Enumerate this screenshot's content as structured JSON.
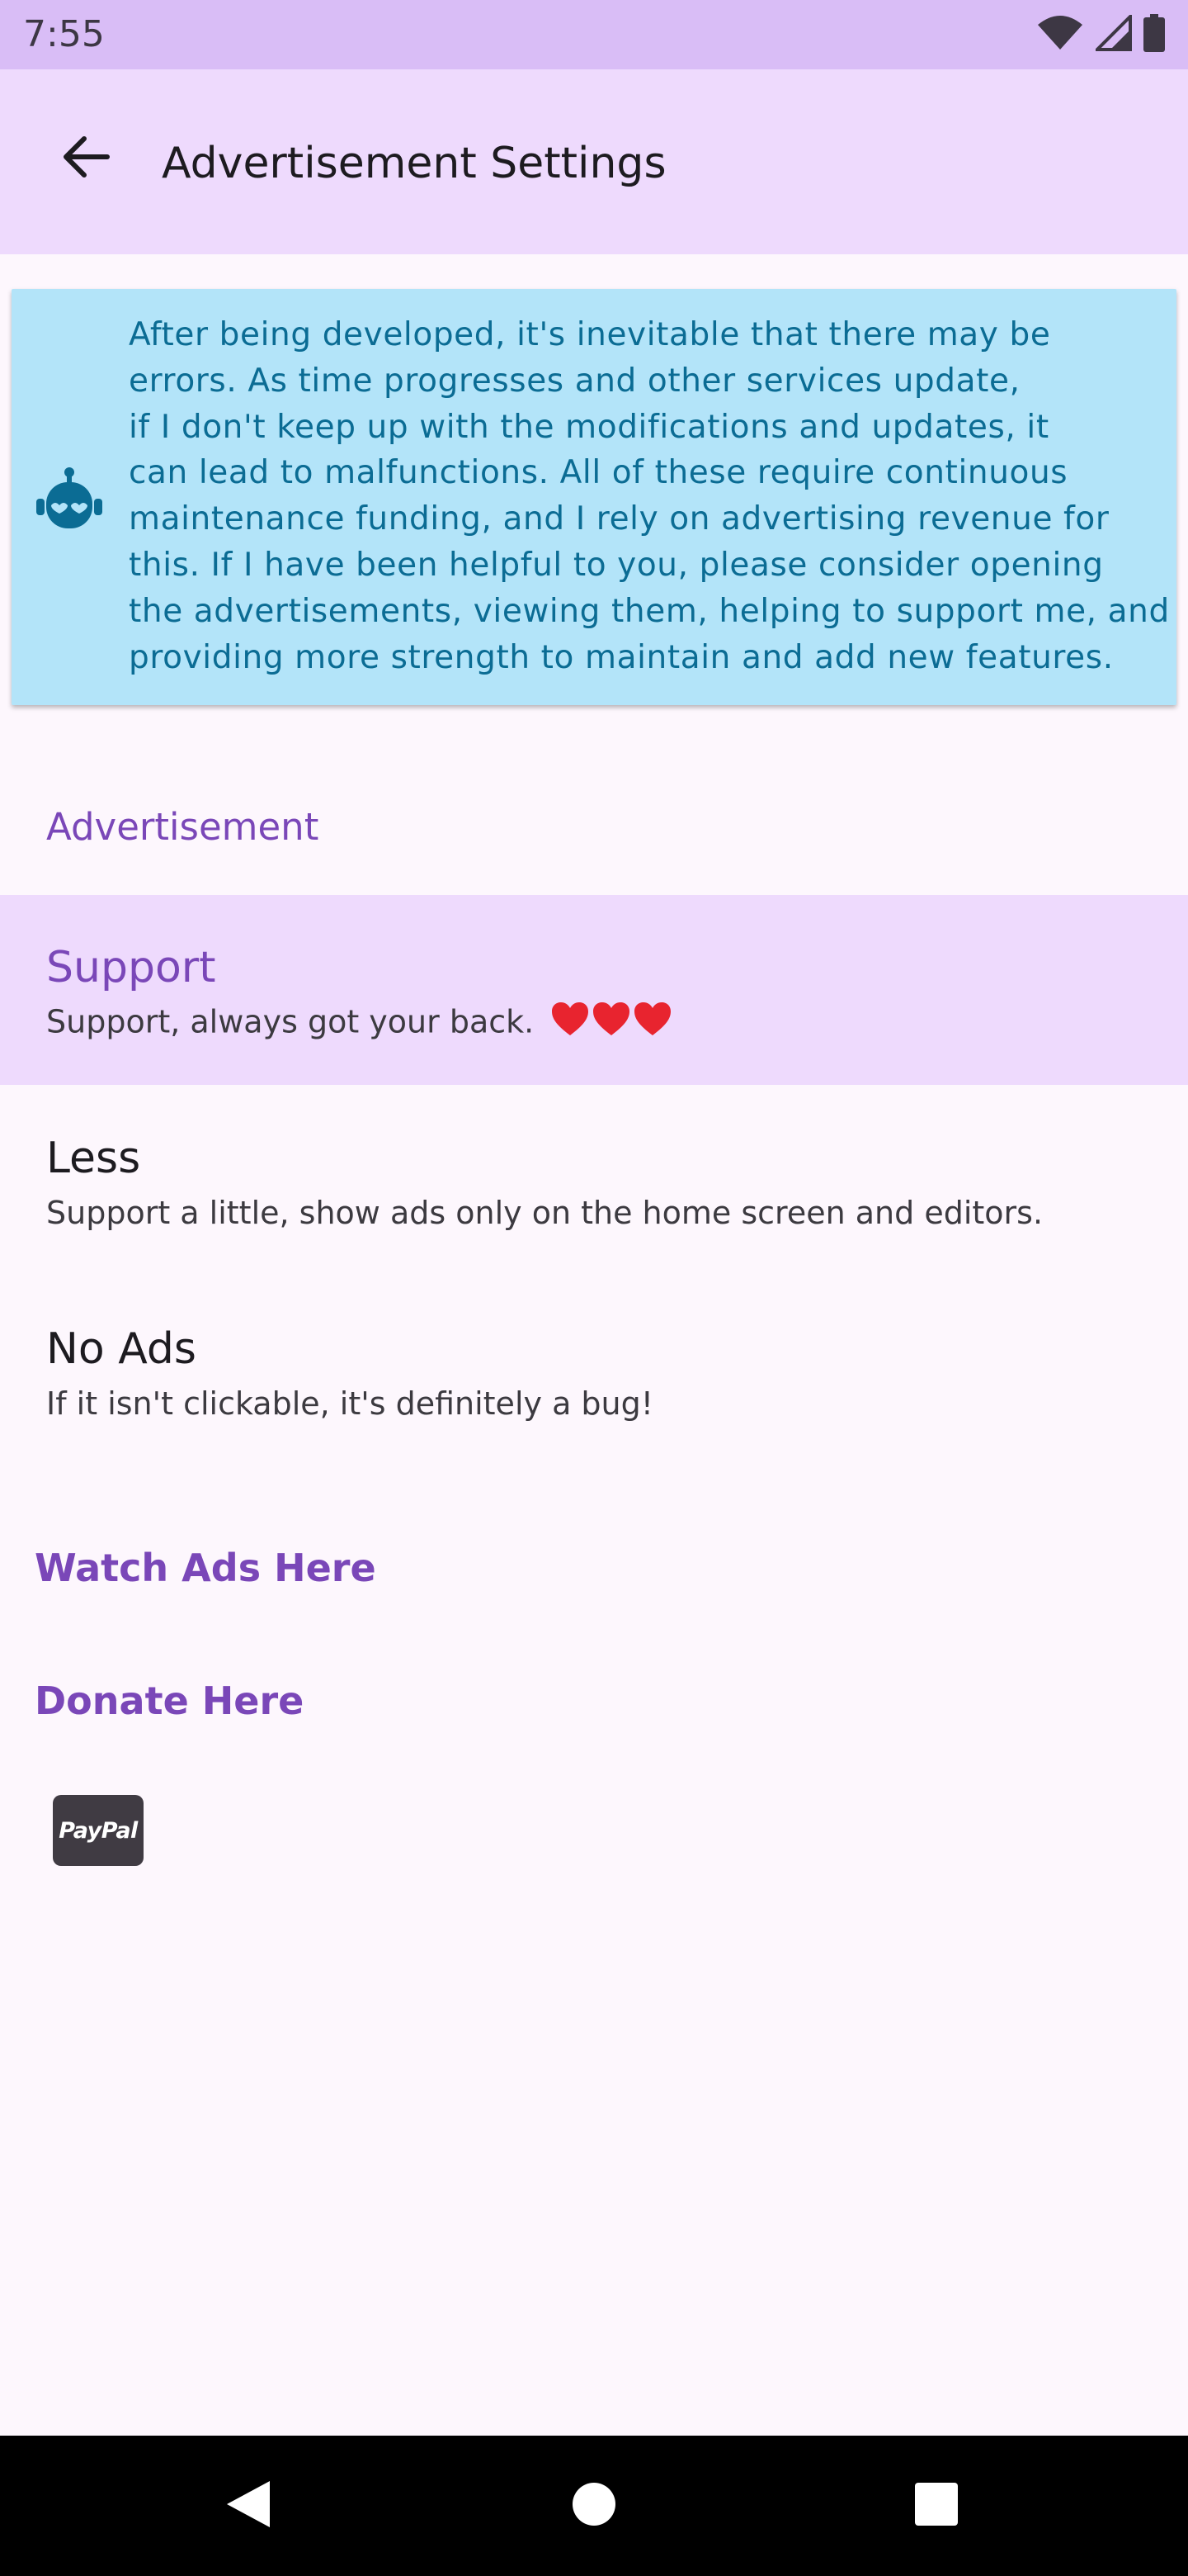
{
  "status_bar": {
    "time": "7:55",
    "icons": [
      "wifi-icon",
      "signal-icon",
      "battery-icon"
    ]
  },
  "app_bar": {
    "title": "Advertisement Settings",
    "back_icon": "arrow-back-icon"
  },
  "info_card": {
    "icon": "robot-icon",
    "lines": [
      "After being developed, it's inevitable that there may be",
      "errors. As time progresses and other services update,",
      "if I don't keep up with the modifications and updates, it",
      "can lead to malfunctions. All of these require continuous",
      "maintenance funding, and I rely on advertising revenue for",
      "this. If I have been helpful to you, please consider opening",
      "the advertisements, viewing them, helping to support me, and",
      "providing more strength to maintain and add new features."
    ],
    "background_color": "#b3e4f9",
    "text_color": "#0b6c94"
  },
  "section": {
    "label": "Advertisement"
  },
  "options": [
    {
      "title": "Support",
      "summary": "Support, always got your back.",
      "hearts": 3,
      "selected": true
    },
    {
      "title": "Less",
      "summary": "Support a little, show ads only on the home screen and editors.",
      "selected": false
    },
    {
      "title": "No Ads",
      "summary": "If it isn't clickable, it's definitely a bug!",
      "selected": false
    }
  ],
  "links": {
    "watch_ads": "Watch Ads Here",
    "donate": "Donate Here"
  },
  "paypal": {
    "label": "PayPal"
  },
  "nav_bar": {
    "back": "nav-back-icon",
    "home": "nav-home-icon",
    "recents": "nav-recents-icon"
  },
  "colors": {
    "status_bar": "#d9bdf6",
    "app_bar": "#eedafd",
    "accent": "#7a47b8",
    "background": "#fdf7fd",
    "heart": "#e8242f"
  }
}
